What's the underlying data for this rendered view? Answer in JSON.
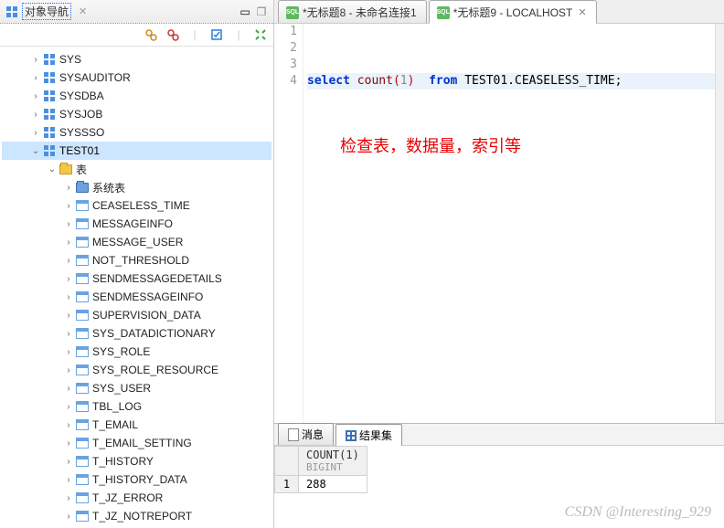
{
  "sidebar": {
    "title": "对象导航",
    "schemas": [
      {
        "label": "SYS"
      },
      {
        "label": "SYSAUDITOR"
      },
      {
        "label": "SYSDBA"
      },
      {
        "label": "SYSJOB"
      },
      {
        "label": "SYSSSO"
      },
      {
        "label": "TEST01",
        "expanded": true
      }
    ],
    "group_label": "表",
    "system_tables_label": "系统表",
    "tables": [
      "CEASELESS_TIME",
      "MESSAGEINFO",
      "MESSAGE_USER",
      "NOT_THRESHOLD",
      "SENDMESSAGEDETAILS",
      "SENDMESSAGEINFO",
      "SUPERVISION_DATA",
      "SYS_DATADICTIONARY",
      "SYS_ROLE",
      "SYS_ROLE_RESOURCE",
      "SYS_USER",
      "TBL_LOG",
      "T_EMAIL",
      "T_EMAIL_SETTING",
      "T_HISTORY",
      "T_HISTORY_DATA",
      "T_JZ_ERROR",
      "T_JZ_NOTREPORT"
    ]
  },
  "tabs": [
    {
      "label": "*无标题8 - 未命名连接1",
      "active": false
    },
    {
      "label": "*无标题9 - LOCALHOST",
      "active": true
    }
  ],
  "editor": {
    "lines": [
      "1",
      "2",
      "3",
      "4"
    ],
    "sql": {
      "kw1": "select",
      "fn": "count",
      "lp": "(",
      "arg": "1",
      "rp": ")",
      "kw2": "from",
      "tbl": "TEST01.CEASELESS_TIME",
      "end": ";"
    },
    "annotation": "检查表，数据量，索引等"
  },
  "result_tabs": [
    {
      "label": "消息"
    },
    {
      "label": "结果集"
    }
  ],
  "result": {
    "header": "COUNT(1)",
    "type": "BIGINT",
    "row_index": "1",
    "value": "288"
  },
  "watermark": "CSDN @Interesting_929"
}
